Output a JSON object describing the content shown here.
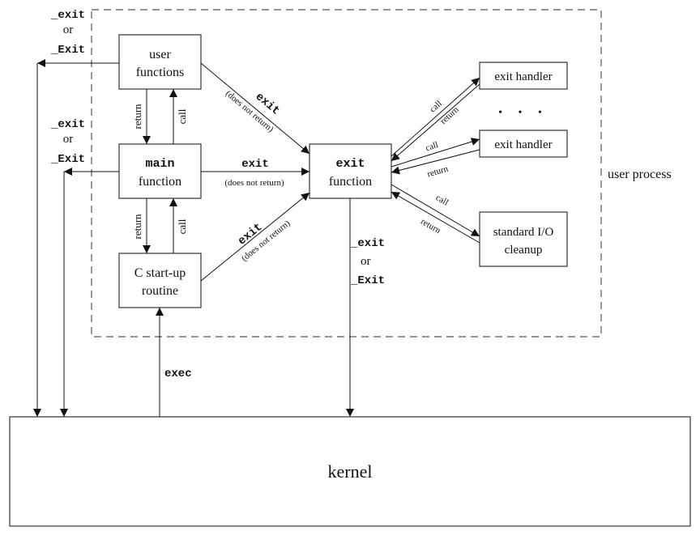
{
  "diagram": {
    "region_label": "user process",
    "boxes": {
      "user_functions": [
        "user",
        "functions"
      ],
      "main_function": [
        "main",
        "function"
      ],
      "startup_routine": [
        "C start-up",
        "routine"
      ],
      "exit_function": [
        "exit",
        "function"
      ],
      "exit_handler_1": "exit handler",
      "exit_handler_2": "exit handler",
      "stdio_cleanup": [
        "standard I/O",
        "cleanup"
      ],
      "kernel": "kernel"
    },
    "labels": {
      "exit_or_1": [
        "_exit",
        "or",
        "_Exit"
      ],
      "exit_or_2": [
        "_exit",
        "or",
        "_Exit"
      ],
      "exit_or_3": [
        "_exit",
        "or",
        "_Exit"
      ],
      "return": "return",
      "call": "call",
      "exit": "exit",
      "does_not_return": "(does not return)",
      "exec": "exec",
      "ellipsis": "• • •"
    }
  }
}
